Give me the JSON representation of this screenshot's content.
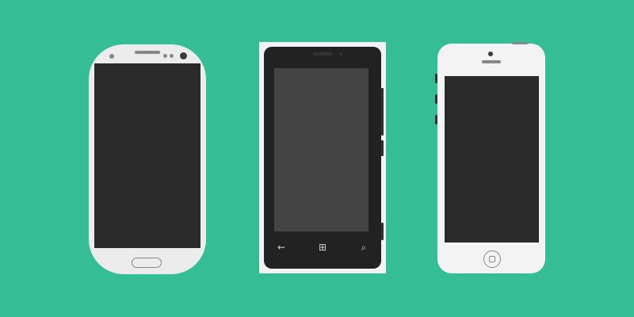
{
  "colors": {
    "background": "#35bd96",
    "white_body": "#ececec",
    "white_body_alt": "#f3f3f3",
    "dark_body": "#222222",
    "screen_dark": "#2a2a2a",
    "screen_gray": "#444444",
    "detail_gray": "#888888",
    "detail_dark": "#333333",
    "glyph": "#cfcfcf",
    "camera": "#3a3a3a"
  },
  "phones": [
    {
      "name": "android-phone",
      "icons": [
        "earpiece",
        "sensor-dots",
        "front-camera",
        "home-button"
      ]
    },
    {
      "name": "windows-phone",
      "nav_glyphs": {
        "back": "←",
        "windows": "⊞",
        "search": "⌕"
      },
      "icons": [
        "back-icon",
        "windows-logo-icon",
        "search-icon"
      ]
    },
    {
      "name": "iphone",
      "icons": [
        "front-camera",
        "earpiece",
        "home-button"
      ]
    }
  ]
}
